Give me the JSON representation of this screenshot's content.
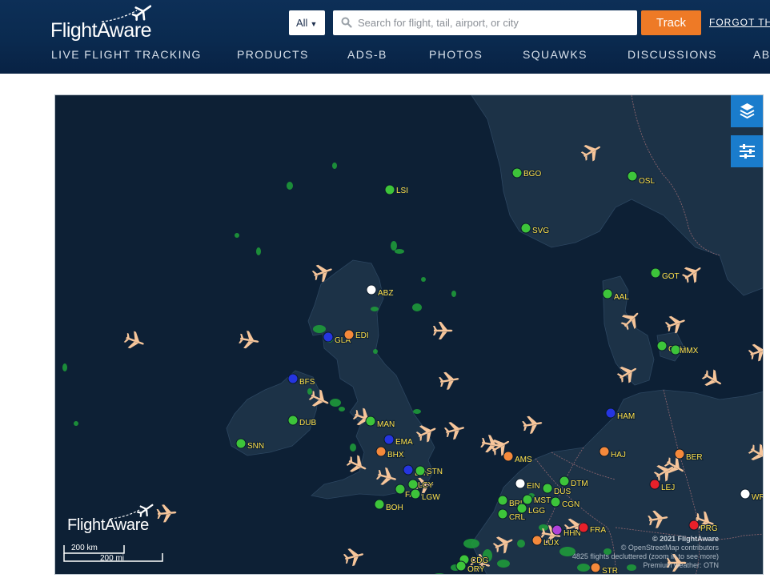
{
  "header": {
    "logo_text": "FlightAware",
    "search_type": "All",
    "search_placeholder": "Search for flight, tail, airport, or city",
    "track_label": "Track",
    "forgot_label": "FORGOT TH",
    "nav": [
      "LIVE FLIGHT TRACKING",
      "PRODUCTS",
      "ADS-B",
      "PHOTOS",
      "SQUAWKS",
      "DISCUSSIONS",
      "AB"
    ]
  },
  "map": {
    "logo_text": "FlightAware",
    "scale_km": "200 km",
    "scale_mi": "200 mi",
    "credits": [
      "© 2021 FlightAware",
      "© OpenStreetMap contributors",
      "4825 flights decluttered (zoom in to see more)",
      "Premium weather: OTN"
    ],
    "colors": {
      "ocean": "#0d2035",
      "land": "#1c3247",
      "green": "#3dc43a",
      "orange": "#f5893b",
      "blue": "#2535e0",
      "red": "#e8202a",
      "white": "#ffffff",
      "purple": "#b042d9",
      "plane": "#f6c59a",
      "label": "#ffe14a"
    },
    "airports": [
      {
        "code": "LSI",
        "color": "green"
      },
      {
        "code": "BGO",
        "color": "green"
      },
      {
        "code": "OSL",
        "color": "green"
      },
      {
        "code": "SVG",
        "color": "green"
      },
      {
        "code": "GOT",
        "color": "green"
      },
      {
        "code": "ABZ",
        "color": "white"
      },
      {
        "code": "AAL",
        "color": "green"
      },
      {
        "code": "GLA",
        "color": "blue"
      },
      {
        "code": "EDI",
        "color": "orange"
      },
      {
        "code": "CPH",
        "color": "green"
      },
      {
        "code": "MMX",
        "color": "green"
      },
      {
        "code": "BFS",
        "color": "blue"
      },
      {
        "code": "DUB",
        "color": "green"
      },
      {
        "code": "MAN",
        "color": "green"
      },
      {
        "code": "HAM",
        "color": "blue"
      },
      {
        "code": "SNN",
        "color": "green"
      },
      {
        "code": "EMA",
        "color": "blue"
      },
      {
        "code": "BHX",
        "color": "orange"
      },
      {
        "code": "AMS",
        "color": "orange"
      },
      {
        "code": "HAJ",
        "color": "orange"
      },
      {
        "code": "BER",
        "color": "orange"
      },
      {
        "code": "LTN",
        "color": "blue"
      },
      {
        "code": "STN",
        "color": "green"
      },
      {
        "code": "FAB",
        "color": "green"
      },
      {
        "code": "LCY",
        "color": "green"
      },
      {
        "code": "LGW",
        "color": "green"
      },
      {
        "code": "EIN",
        "color": "white"
      },
      {
        "code": "DTM",
        "color": "green"
      },
      {
        "code": "DUS",
        "color": "green"
      },
      {
        "code": "LEJ",
        "color": "red"
      },
      {
        "code": "WR",
        "color": "white"
      },
      {
        "code": "BRU",
        "color": "green"
      },
      {
        "code": "MST",
        "color": "green"
      },
      {
        "code": "CGN",
        "color": "green"
      },
      {
        "code": "BOH",
        "color": "green"
      },
      {
        "code": "CRL",
        "color": "green"
      },
      {
        "code": "LGG",
        "color": "green"
      },
      {
        "code": "HHN",
        "color": "purple"
      },
      {
        "code": "FRA",
        "color": "red"
      },
      {
        "code": "PRG",
        "color": "red"
      },
      {
        "code": "LUX",
        "color": "orange"
      },
      {
        "code": "CDG",
        "color": "green"
      },
      {
        "code": "ORY",
        "color": "green"
      },
      {
        "code": "STR",
        "color": "orange"
      }
    ]
  }
}
